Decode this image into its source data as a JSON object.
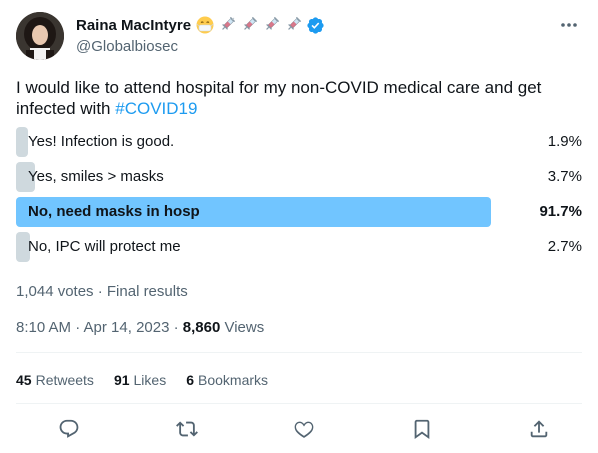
{
  "author": {
    "display_name": "Raina MacIntyre",
    "handle": "@Globalbiosec",
    "emojis": [
      "mask-face-emoji",
      "syringe-emoji",
      "syringe-emoji",
      "syringe-emoji",
      "syringe-emoji"
    ],
    "verified": true,
    "verified_color": "#1d9bf0"
  },
  "tweet": {
    "text": "I would like to attend hospital for my non-COVID medical care and get infected with ",
    "hashtag": "#COVID19",
    "hashtag_color": "#1d9bf0"
  },
  "poll": {
    "options": [
      {
        "label": "Yes! Infection is good.",
        "percent_text": "1.9%",
        "percent": 1.9,
        "winner": false
      },
      {
        "label": "Yes, smiles > masks",
        "percent_text": "3.7%",
        "percent": 3.7,
        "winner": false
      },
      {
        "label": "No, need masks in hosp",
        "percent_text": "91.7%",
        "percent": 91.7,
        "winner": true
      },
      {
        "label": "No, IPC will protect me",
        "percent_text": "2.7%",
        "percent": 2.7,
        "winner": false
      }
    ],
    "meta": "1,044 votes · Final results",
    "winner_color": "#71c5ff",
    "bar_color": "#cfd9de"
  },
  "timestamp": {
    "time": "8:10 AM · Apr 14, 2023 · ",
    "views_count": "8,860",
    "views_label": " Views"
  },
  "stats": {
    "retweets_count": "45",
    "retweets_label": "Retweets",
    "likes_count": "91",
    "likes_label": "Likes",
    "bookmarks_count": "6",
    "bookmarks_label": "Bookmarks"
  },
  "actions": [
    "reply-icon",
    "retweet-icon",
    "like-icon",
    "bookmark-icon",
    "share-icon"
  ]
}
